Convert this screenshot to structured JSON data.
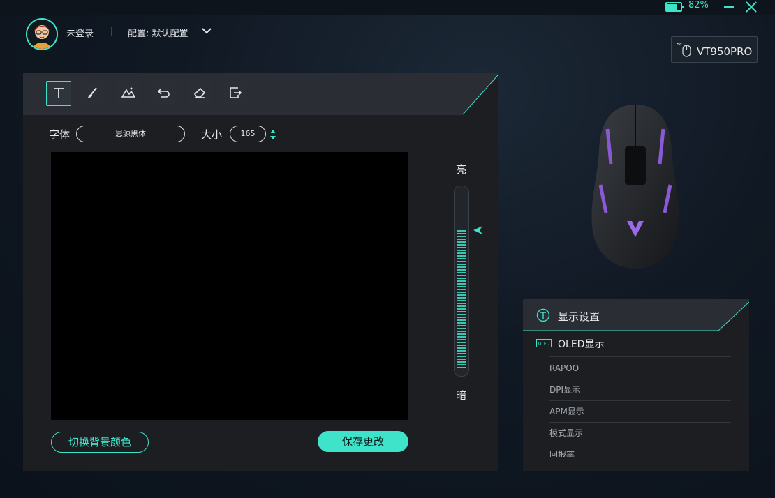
{
  "window": {
    "battery_percent": "82%"
  },
  "header": {
    "login_status": "未登录",
    "separator": "|",
    "profile": "配置: 默认配置"
  },
  "device": {
    "name": "VT950PRO"
  },
  "editor": {
    "font_label": "字体",
    "font_value": "思源黑体",
    "size_label": "大小",
    "size_value": "165",
    "bright_label": "亮",
    "dark_label": "暗",
    "brightness_level": 0.75,
    "bg_color_button": "切换背景颜色",
    "save_button": "保存更改",
    "tools": [
      "text-icon",
      "brush-icon",
      "image-icon",
      "undo-icon",
      "eraser-icon",
      "export-icon"
    ]
  },
  "display_settings": {
    "title": "显示设置",
    "oled_badge": "OLED",
    "oled_title": "OLED显示",
    "items": [
      "RAPOO",
      "DPI显示",
      "APM显示",
      "模式显示",
      "回报率"
    ]
  },
  "colors": {
    "accent": "#3fe3c9",
    "panel": "#1c1e22",
    "background": "#0f1720"
  }
}
